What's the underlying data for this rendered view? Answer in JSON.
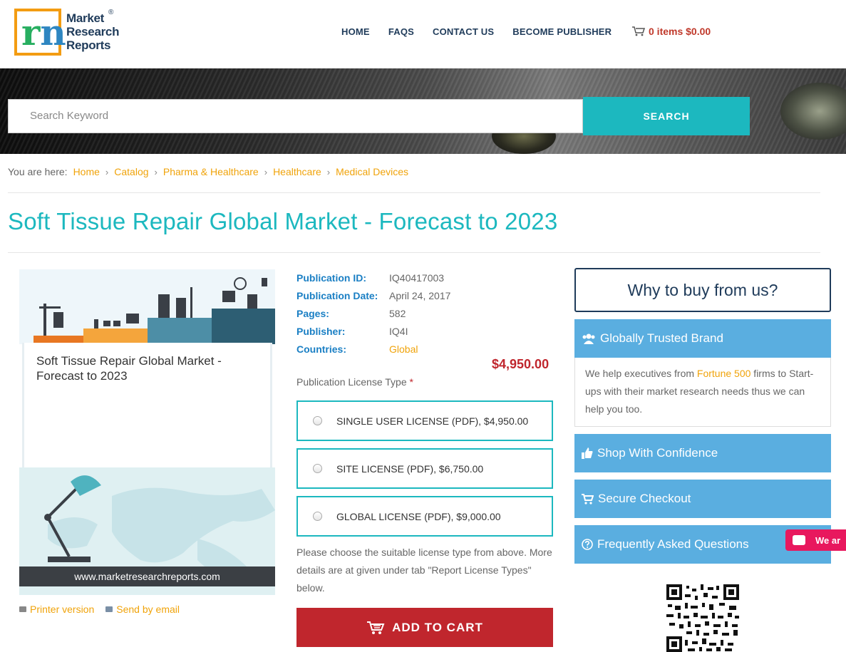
{
  "header": {
    "logo_lines": [
      "Market",
      "Research",
      "Reports"
    ],
    "logo_reg": "®",
    "nav": [
      "HOME",
      "FAQS",
      "CONTACT US",
      "BECOME PUBLISHER"
    ],
    "cart_text": "0 items $0.00"
  },
  "search": {
    "placeholder": "Search Keyword",
    "button": "SEARCH"
  },
  "breadcrumb": {
    "here": "You are here:",
    "items": [
      "Home",
      "Catalog",
      "Pharma & Healthcare",
      "Healthcare",
      "Medical Devices"
    ]
  },
  "page_title": "Soft Tissue Repair Global Market - Forecast to 2023",
  "cover": {
    "title": "Soft Tissue Repair Global Market - Forecast to 2023",
    "url": "www.marketresearchreports.com"
  },
  "links": {
    "print": "Printer version",
    "email": "Send by email"
  },
  "details": [
    {
      "label": "Publication ID:",
      "value": "IQ40417003"
    },
    {
      "label": "Publication Date:",
      "value": "April 24, 2017"
    },
    {
      "label": "Pages:",
      "value": "582"
    },
    {
      "label": "Publisher:",
      "value": "IQ4I"
    },
    {
      "label": "Countries:",
      "value": "Global"
    }
  ],
  "price": "$4,950.00",
  "license": {
    "label": "Publication License Type",
    "required": "*",
    "options": [
      "SINGLE USER LICENSE (PDF), $4,950.00",
      "SITE LICENSE (PDF), $6,750.00",
      "GLOBAL LICENSE (PDF), $9,000.00"
    ],
    "note": "Please choose the suitable license type from above. More details are at given under tab \"Report License Types\" below."
  },
  "add_to_cart": "ADD TO CART",
  "sidebar": {
    "why_title": "Why to buy from us?",
    "panels": [
      "Globally Trusted Brand",
      "Shop With Confidence",
      "Secure Checkout",
      "Frequently Asked Questions"
    ],
    "trusted_body_pre": "We help executives from ",
    "trusted_body_link": "Fortune 500",
    "trusted_body_post": " firms to Start-ups with their market research needs thus we can help you too."
  },
  "chat": {
    "text": "We ar"
  },
  "colors": {
    "accent": "#1cb8bf",
    "link": "#f0a30a",
    "cta": "#c0262d",
    "panel": "#5aaee0",
    "navy": "#1f3b5a"
  }
}
